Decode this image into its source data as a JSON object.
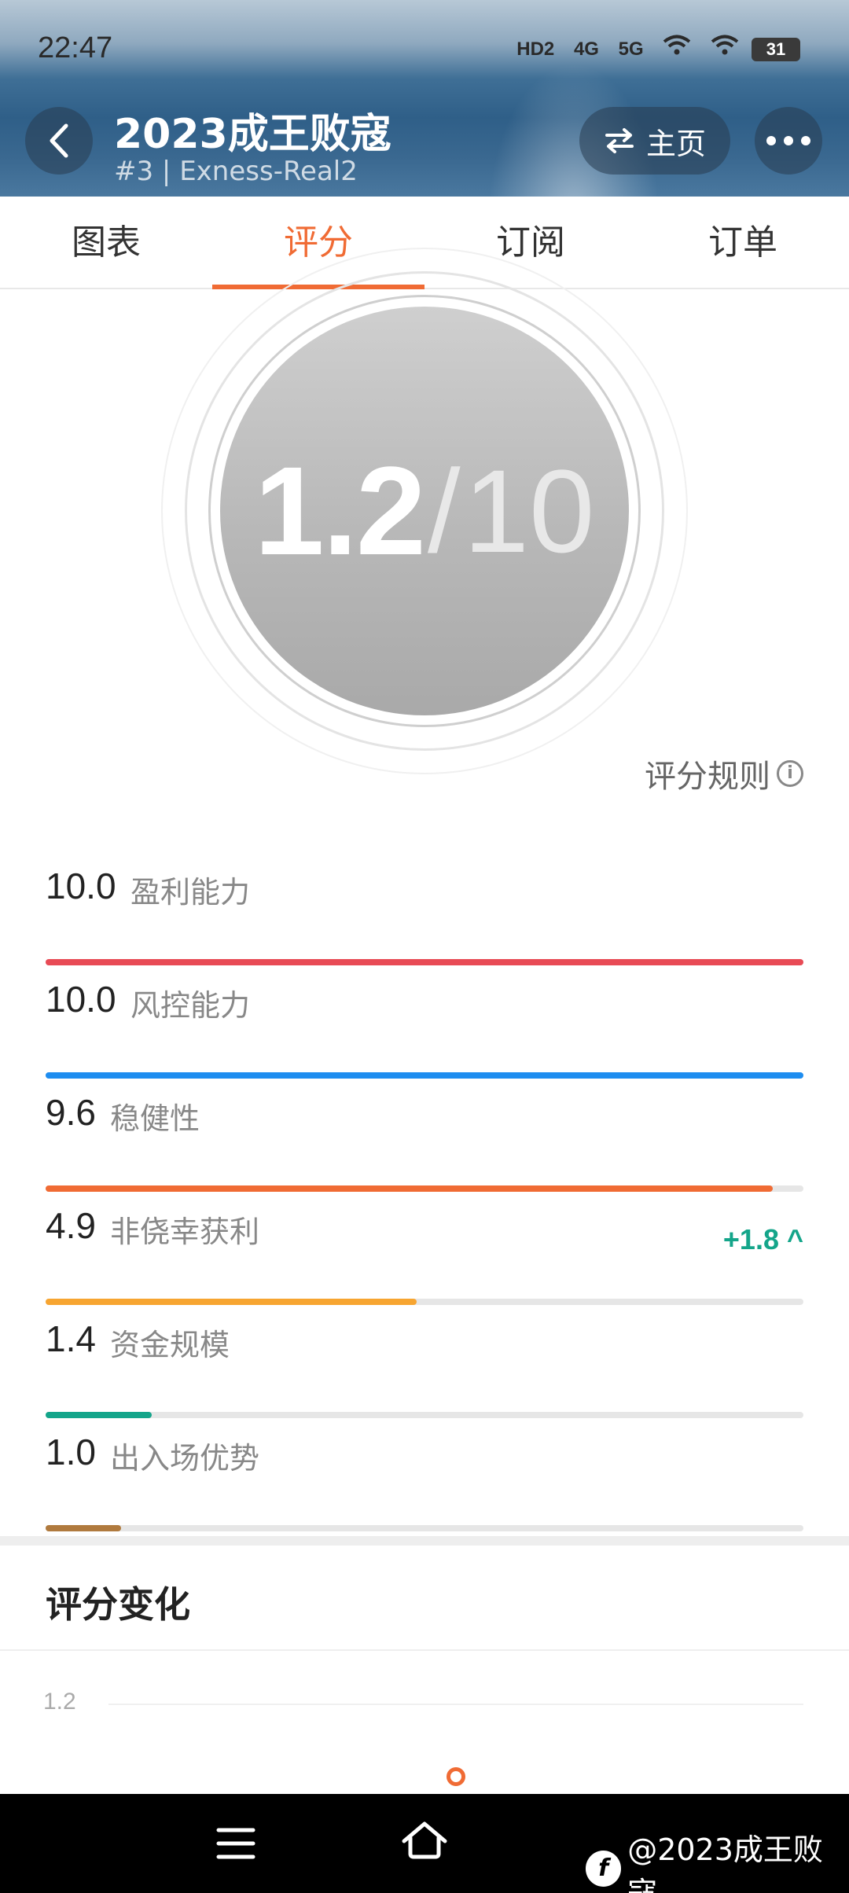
{
  "status_bar": {
    "time": "22:47",
    "icons": [
      "HD2",
      "4G",
      "5G",
      "wifi",
      "wifi"
    ],
    "battery": "31"
  },
  "header": {
    "title": "2023成王败寇",
    "subtitle": "#3 | Exness-Real2",
    "home_label": "主页"
  },
  "tabs": [
    {
      "label": "图表",
      "active": false
    },
    {
      "label": "评分",
      "active": true
    },
    {
      "label": "订阅",
      "active": false
    },
    {
      "label": "订单",
      "active": false
    }
  ],
  "score": {
    "value": "1.2",
    "separator": "/",
    "max": "10"
  },
  "rules_label": "评分规则",
  "metrics": [
    {
      "value": "10.0",
      "label": "盈利能力",
      "fraction": 1.0,
      "color": "#e84a55"
    },
    {
      "value": "10.0",
      "label": "风控能力",
      "fraction": 1.0,
      "color": "#1e8df0"
    },
    {
      "value": "9.6",
      "label": "稳健性",
      "fraction": 0.96,
      "color": "#f06b34"
    },
    {
      "value": "4.9",
      "label": "非侥幸获利",
      "fraction": 0.49,
      "color": "#f7a531",
      "delta": "+1.8 ^"
    },
    {
      "value": "1.4",
      "label": "资金规模",
      "fraction": 0.14,
      "color": "#14a58a"
    },
    {
      "value": "1.0",
      "label": "出入场优势",
      "fraction": 0.1,
      "color": "#b07a3e"
    }
  ],
  "score_change": {
    "title": "评分变化",
    "axis_label": "1.2"
  },
  "watermark": "@2023成王败寇",
  "accent_color": "#f06b34"
}
